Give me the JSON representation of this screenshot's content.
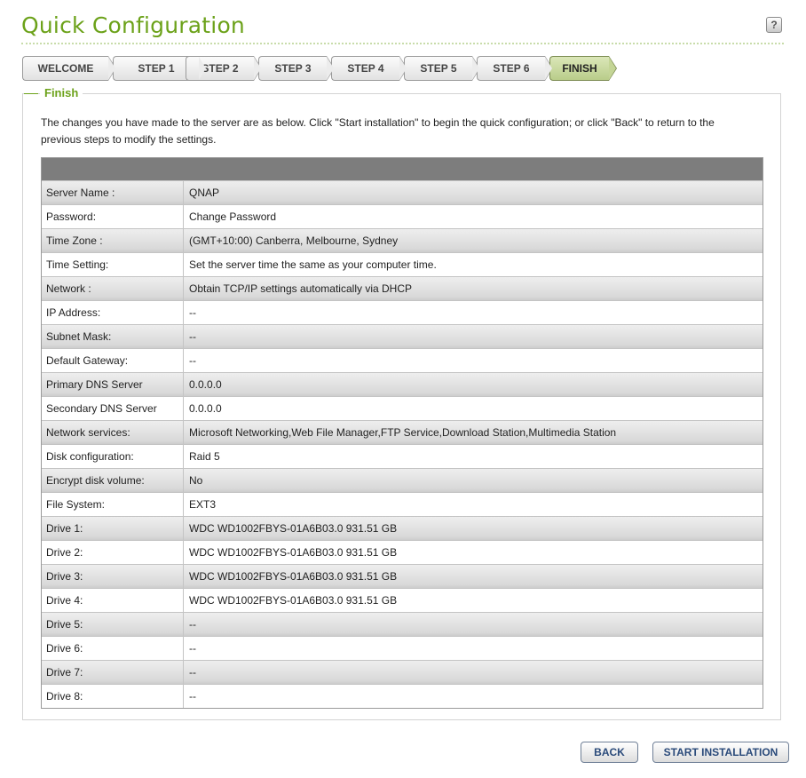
{
  "header": {
    "title": "Quick Configuration",
    "help_symbol": "?"
  },
  "steps": [
    {
      "label": "WELCOME",
      "active": false
    },
    {
      "label": "STEP 1",
      "active": false
    },
    {
      "label": "STEP 2",
      "active": false
    },
    {
      "label": "STEP 3",
      "active": false
    },
    {
      "label": "STEP 4",
      "active": false
    },
    {
      "label": "STEP 5",
      "active": false
    },
    {
      "label": "STEP 6",
      "active": false
    },
    {
      "label": "FINISH",
      "active": true
    }
  ],
  "finish": {
    "legend": "Finish",
    "intro": "The changes you have made to the server are as below. Click \"Start installation\" to begin the quick configuration; or click \"Back\" to return to the previous steps to modify the settings."
  },
  "summary_rows": [
    {
      "label": "Server Name :",
      "value": "QNAP"
    },
    {
      "label": "Password:",
      "value": "Change Password"
    },
    {
      "label": "Time Zone :",
      "value": "(GMT+10:00) Canberra, Melbourne, Sydney"
    },
    {
      "label": "Time Setting:",
      "value": "Set the server time the same as your computer time."
    },
    {
      "label": "Network :",
      "value": "Obtain TCP/IP settings automatically via DHCP"
    },
    {
      "label": "IP Address:",
      "value": "--"
    },
    {
      "label": "Subnet Mask:",
      "value": "--"
    },
    {
      "label": "Default Gateway:",
      "value": "--"
    },
    {
      "label": "Primary DNS Server",
      "value": "0.0.0.0"
    },
    {
      "label": "Secondary DNS Server",
      "value": "0.0.0.0"
    },
    {
      "label": "Network services:",
      "value": "Microsoft Networking,Web File Manager,FTP Service,Download Station,Multimedia Station"
    },
    {
      "label": "Disk configuration:",
      "value": "Raid 5"
    },
    {
      "label": "Encrypt disk volume:",
      "value": "No"
    },
    {
      "label": "File System:",
      "value": "EXT3"
    },
    {
      "label": "Drive 1:",
      "value": "WDC WD1002FBYS-01A6B03.0 931.51 GB"
    },
    {
      "label": "Drive 2:",
      "value": "WDC WD1002FBYS-01A6B03.0 931.51 GB"
    },
    {
      "label": "Drive 3:",
      "value": "WDC WD1002FBYS-01A6B03.0 931.51 GB"
    },
    {
      "label": "Drive 4:",
      "value": "WDC WD1002FBYS-01A6B03.0 931.51 GB"
    },
    {
      "label": "Drive 5:",
      "value": "--"
    },
    {
      "label": "Drive 6:",
      "value": "--"
    },
    {
      "label": "Drive 7:",
      "value": "--"
    },
    {
      "label": "Drive 8:",
      "value": "--"
    }
  ],
  "buttons": {
    "back": "BACK",
    "start": "START INSTALLATION"
  },
  "colors": {
    "title_green": "#6ca21a",
    "active_step": "#c4d596",
    "table_header": "#7d7d7d",
    "button_text": "#2a4a7a"
  }
}
